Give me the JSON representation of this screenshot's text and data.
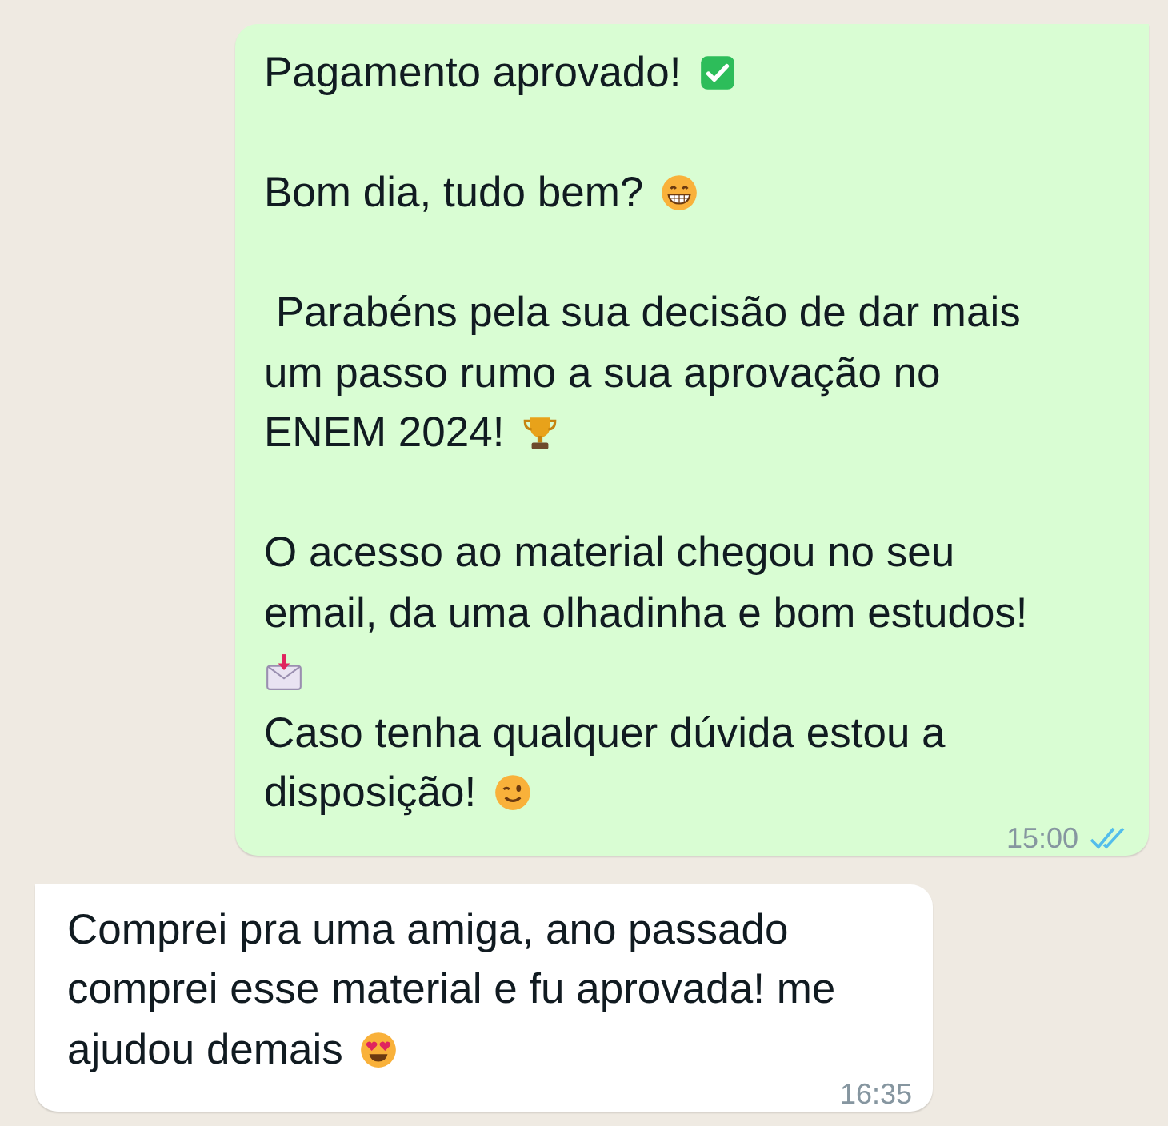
{
  "messages": [
    {
      "kind": "outgoing",
      "time": "15:00",
      "read": true,
      "blocks": [
        {
          "lines": [
            {
              "text": "Pagamento aprovado!",
              "emoji": {
                "kind": "check"
              }
            }
          ]
        },
        {
          "lines": [
            {
              "text": "Bom dia, tudo bem?",
              "emoji": {
                "kind": "grin"
              }
            }
          ]
        },
        {
          "lines": [
            {
              "text": " Parabéns pela sua decisão de dar mais um passo rumo a sua aprovação no ENEM 2024!",
              "emoji": {
                "kind": "trophy"
              }
            }
          ]
        },
        {
          "lines": [
            {
              "text": "O acesso ao material chegou no seu email, da uma olhadinha e bom estudos!"
            },
            {
              "emoji": {
                "kind": "envelope"
              }
            },
            {
              "text": "Caso tenha qualquer dúvida estou a disposição!",
              "emoji": {
                "kind": "wink"
              }
            }
          ]
        }
      ]
    },
    {
      "kind": "incoming",
      "time": "16:35",
      "blocks": [
        {
          "lines": [
            {
              "text": "Comprei pra uma amiga, ano passado comprei esse material e fu aprovada! me ajudou demais",
              "emoji": {
                "kind": "hearteyes"
              }
            }
          ]
        }
      ]
    }
  ]
}
